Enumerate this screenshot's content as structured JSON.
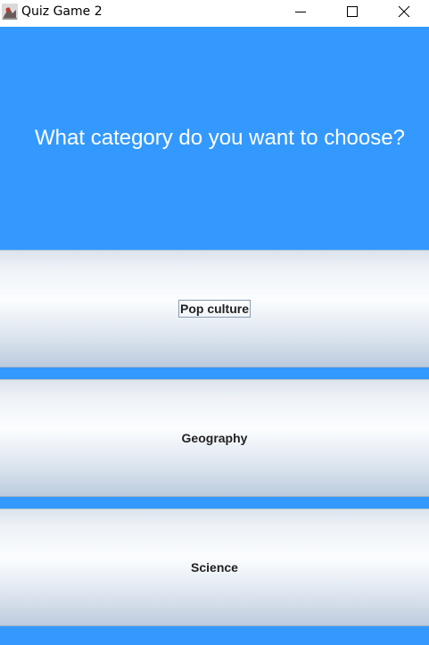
{
  "window": {
    "title": "Quiz Game 2",
    "icon": "java-app-icon",
    "controls": [
      "minimize-icon",
      "maximize-icon",
      "close-icon"
    ]
  },
  "colors": {
    "background": "#3399ff",
    "question_text": "#ffffff",
    "button_text": "#222222"
  },
  "question": {
    "text": "What category do you want to choose?"
  },
  "categories": [
    {
      "label": "Pop culture",
      "focused": true
    },
    {
      "label": "Geography",
      "focused": false
    },
    {
      "label": "Science",
      "focused": false
    }
  ]
}
